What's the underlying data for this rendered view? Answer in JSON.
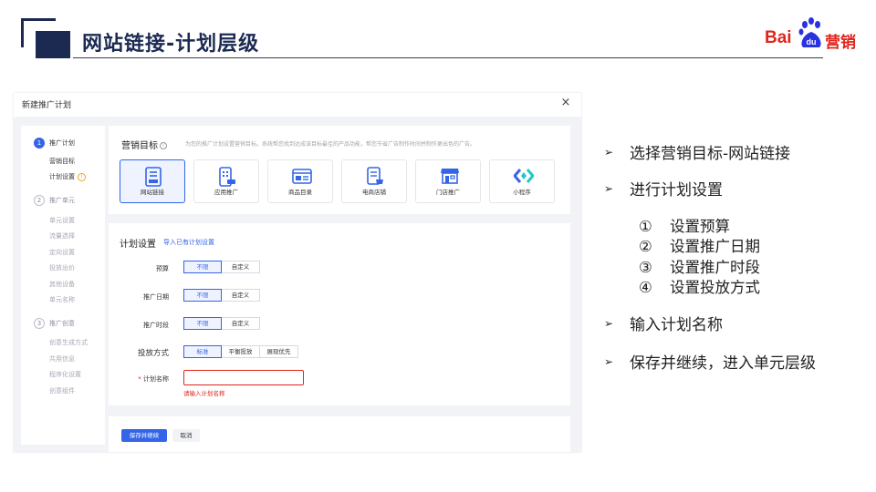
{
  "slide": {
    "title": "网站链接-计划层级",
    "brand": {
      "left": "Bai",
      "paw": "du",
      "right": "营销",
      "color": "#e1251b"
    },
    "accent": "#1c2a52"
  },
  "dialog": {
    "title": "新建推广计划",
    "close": "×",
    "sidebar": {
      "steps": [
        {
          "num": "1",
          "label": "推广计划",
          "subs": [
            "营销目标",
            "计划设置"
          ]
        },
        {
          "num": "2",
          "label": "推广单元",
          "subs": [
            "单元设置",
            "流量选择",
            "定向设置",
            "投放出价",
            "其他设备",
            "单元名称"
          ]
        },
        {
          "num": "3",
          "label": "推广创意",
          "subs": [
            "创意生成方式",
            "共用信息",
            "程序化设置",
            "创意组件"
          ]
        }
      ],
      "warning_mark": "!"
    },
    "goal": {
      "title": "营销目标",
      "info_mark": "i",
      "desc": "为您的推广计划设置营销目标。系统帮您找到达成该目标最佳的产品功能，帮您节省广告制作时间并制作更出色的广告。",
      "tiles": [
        "网站链接",
        "应用推广",
        "商品目录",
        "电商店铺",
        "门店推广",
        "小程序"
      ],
      "selected": 0
    },
    "plan": {
      "title": "计划设置",
      "import_link": "导入已有计划设置",
      "budget": {
        "label": "预算",
        "options": [
          "不限",
          "自定义"
        ]
      },
      "date": {
        "label": "推广日期",
        "options": [
          "不限",
          "自定义"
        ]
      },
      "time": {
        "label": "推广时段",
        "options": [
          "不限",
          "自定义"
        ]
      },
      "method": {
        "label": "投放方式",
        "options": [
          "标准",
          "平衡投放",
          "展现优先"
        ]
      },
      "name": {
        "required": "*",
        "label": "计划名称",
        "value": "",
        "error": "请输入计划名称"
      }
    },
    "buttons": {
      "save": "保存并继续",
      "cancel": "取消"
    }
  },
  "bullets": {
    "items": [
      "选择营销目标-网站链接",
      "进行计划设置",
      "输入计划名称",
      "保存并继续，进入单元层级"
    ],
    "arrow": "➢",
    "sub": [
      {
        "mark": "①",
        "text": "设置预算"
      },
      {
        "mark": "②",
        "text": "设置推广日期"
      },
      {
        "mark": "③",
        "text": "设置推广时段"
      },
      {
        "mark": "④",
        "text": "设置投放方式"
      }
    ]
  }
}
